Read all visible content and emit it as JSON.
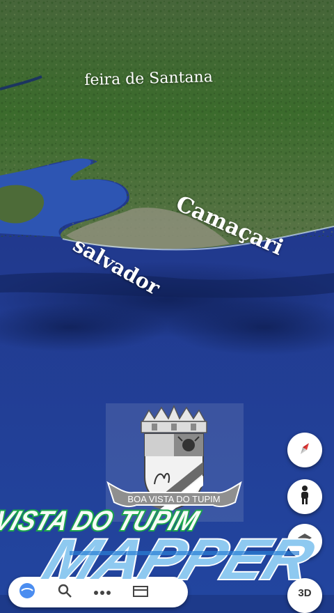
{
  "map": {
    "labels": {
      "feira": "feira de Santana",
      "camacari": "Camaçari",
      "salvador": "salvador"
    }
  },
  "controls": {
    "three_d_label": "3D",
    "icons": [
      "compass-icon",
      "pegman-icon",
      "layers-icon",
      "voyager-icon",
      "search-icon",
      "more-icon"
    ]
  },
  "logo": {
    "ribbon_text": "BOA VISTA DO TUPIM",
    "title_line1": "BOA VISTA DO TUPIM",
    "title_line2": "MAPPER",
    "colors": {
      "green": "#1aa64a",
      "blue": "#2a7fd4",
      "light_blue": "#8ec9f0"
    }
  }
}
